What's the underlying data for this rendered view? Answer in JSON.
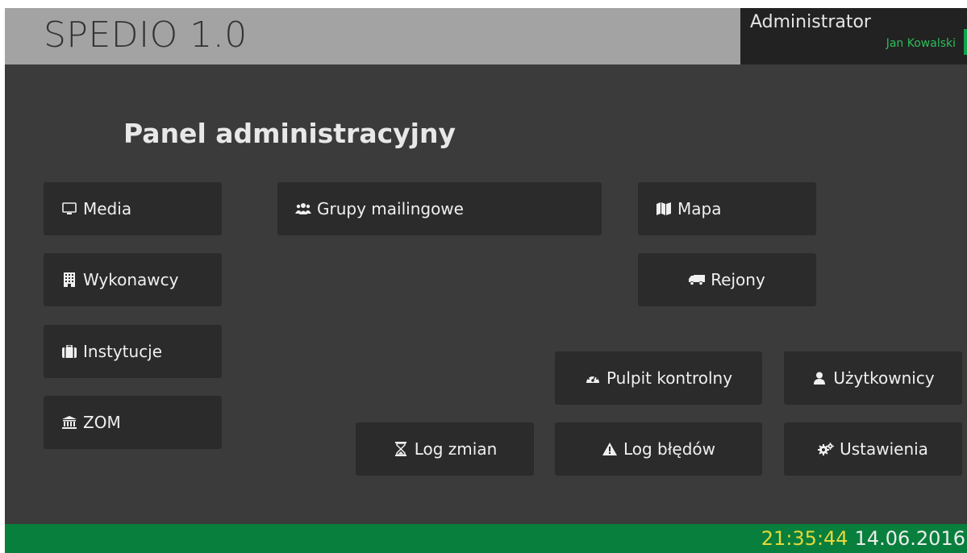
{
  "header": {
    "app_title": "SPEDIO 1.0",
    "user_role": "Administrator",
    "user_name": "Jan Kowalski"
  },
  "main": {
    "page_title": "Panel administracyjny",
    "tiles": {
      "media": {
        "label": "Media",
        "icon": "monitor-icon"
      },
      "grupy": {
        "label": "Grupy mailingowe",
        "icon": "users-icon"
      },
      "mapa": {
        "label": "Mapa",
        "icon": "map-icon"
      },
      "wykonawcy": {
        "label": "Wykonawcy",
        "icon": "building-icon"
      },
      "rejony": {
        "label": "Rejony",
        "icon": "truck-icon"
      },
      "instytucje": {
        "label": "Instytucje",
        "icon": "briefcase-icon"
      },
      "pulpit": {
        "label": "Pulpit kontrolny",
        "icon": "dashboard-icon"
      },
      "uzytkownicy": {
        "label": "Użytkownicy",
        "icon": "user-icon"
      },
      "zom": {
        "label": "ZOM",
        "icon": "institution-icon"
      },
      "log_zmian": {
        "label": "Log zmian",
        "icon": "hourglass-icon"
      },
      "log_bledow": {
        "label": "Log błędów",
        "icon": "warning-icon"
      },
      "ustawienia": {
        "label": "Ustawienia",
        "icon": "gears-icon"
      }
    }
  },
  "footer": {
    "time": "21:35:44",
    "date": "14.06.2016"
  },
  "colors": {
    "background": "#3b3b3b",
    "header": "#a3a3a3",
    "tile": "#2b2b2b",
    "footer": "#087f3c",
    "accent_green": "#2fbd5c",
    "time_yellow": "#e6d83a"
  }
}
